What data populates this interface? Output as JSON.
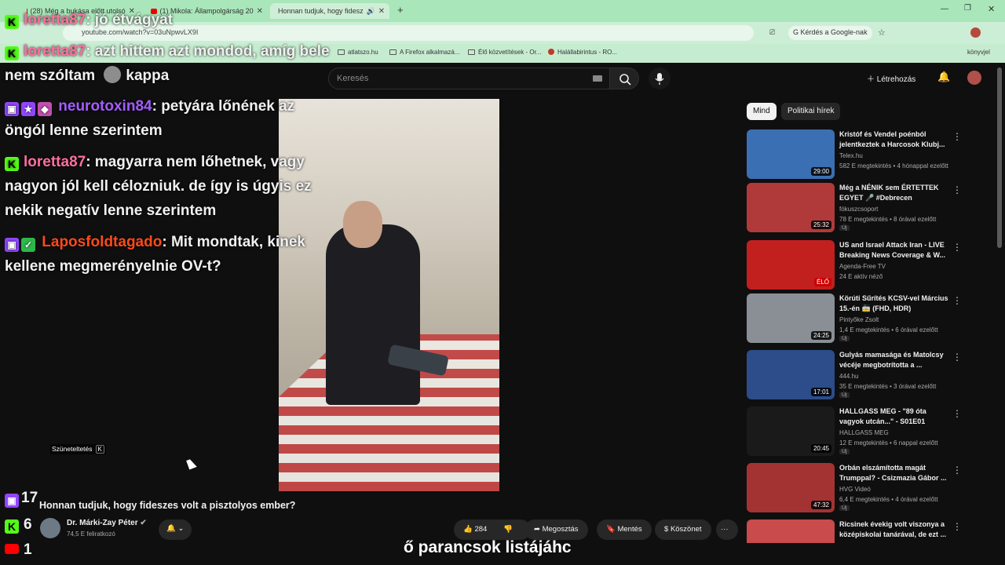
{
  "browser": {
    "tabs": [
      {
        "label": "(28) Még a bukása előtt utolsó",
        "active": false
      },
      {
        "label": "(1) Mikola: Állampolgárság 20",
        "active": false
      },
      {
        "label": "Honnan tudjuk, hogy fidesz",
        "active": true
      }
    ],
    "new_tab_symbol": "+",
    "url": "youtube.com/watch?v=03uNpwvLX9I",
    "google_question": "Kérdés a Google-nak",
    "bookmarks": [
      {
        "label": "atlatszo.hu"
      },
      {
        "label": "A Firefox alkalmazá..."
      },
      {
        "label": "Élő közvetítések - Or..."
      },
      {
        "label": "Halállabirintus - RO..."
      }
    ],
    "bookmarks_right": "könyvjel"
  },
  "youtube": {
    "search_placeholder": "Keresés",
    "create_label": "Létrehozás",
    "chips": [
      "Mind",
      "Politikai hírek"
    ],
    "video_title": "Honnan tudjuk, hogy fideszes volt a pisztolyos ember?",
    "channel_name": "Dr. Márki-Zay Péter",
    "subscribers": "74,5 E feliratkozó",
    "likes": "284",
    "share_label": "Megosztás",
    "save_label": "Mentés",
    "thanks_label": "Köszönet",
    "more_label": "···",
    "pause_hint": "Szüneteltetés",
    "pause_key": "K",
    "recommendations": [
      {
        "title": "Kristóf és Vendel poénból jelentkeztek a Harcosok Klubj...",
        "channel": "Telex.hu",
        "meta": "582 E megtekintés • 4 hónappal ezelőtt",
        "duration": "29:00",
        "new": "",
        "thumb_color": "#3b6fb3"
      },
      {
        "title": "Még a NÉNIK sem ÉRTETTEK EGYET 🎤 #Debrecen",
        "channel": "fókuszcsoport",
        "meta": "78 E megtekintés • 8 órával ezelőtt",
        "duration": "25:32",
        "new": "Új",
        "thumb_color": "#b03a3a"
      },
      {
        "title": "US and Israel Attack Iran - LIVE Breaking News Coverage & W...",
        "channel": "Agenda-Free TV",
        "meta": "24 E aktív néző",
        "duration": "ÉLŐ",
        "new": "",
        "thumb_color": "#c21f1f"
      },
      {
        "title": "Körúti Sűrítés KCSV-vel Március 15.-én 🚋 (FHD, HDR)",
        "channel": "Pintyőke Zsolt",
        "meta": "1,4 E megtekintés • 6 órával ezelőtt",
        "duration": "24:25",
        "new": "Új",
        "thumb_color": "#8a8f96"
      },
      {
        "title": "Gulyás mamasága és Matolcsy vécéje megbotrította a ...",
        "channel": "444.hu",
        "meta": "35 E megtekintés • 3 órával ezelőtt",
        "duration": "17:01",
        "new": "Új",
        "thumb_color": "#2c4d8a"
      },
      {
        "title": "HALLGASS MEG - \"89 óta vagyok utcán...\" - S01E01",
        "channel": "HALLGASS MEG",
        "meta": "12 E megtekintés • 6 nappal ezelőtt",
        "duration": "20:45",
        "new": "Új",
        "thumb_color": "#1a1a1a"
      },
      {
        "title": "Orbán elszámította magát Trumppal? - Csizmazia Gábor ...",
        "channel": "HVG Videó",
        "meta": "6,4 E megtekintés • 4 órával ezelőtt",
        "duration": "47:32",
        "new": "Új",
        "thumb_color": "#a33333"
      },
      {
        "title": "Ricsinek évekig volt viszonya a középiskolai tanárával, de ezt ...",
        "channel": "",
        "meta": "",
        "duration": "",
        "new": "",
        "thumb_color": "#c94b4b"
      }
    ]
  },
  "chat": [
    {
      "platform": "kick",
      "user": "loretta87",
      "user_color": "#ff6fa0",
      "text": ": jó étvágyat"
    },
    {
      "platform": "kick",
      "user": "loretta87",
      "user_color": "#ff6fa0",
      "text": ": azt hittem azt mondod, amíg bele nem szóltam",
      "emote": "kappa"
    },
    {
      "platform": "twitch",
      "user": "neurotoxin84",
      "user_color": "#a45cff",
      "text": ": petyára lőnének az öngól lenne szerintem"
    },
    {
      "platform": "kick",
      "user": "loretta87",
      "user_color": "#ff6fa0",
      "text": ": magyarra nem lőhetnek, vagy nagyon jól kell célozniuk. de így is úgyis ez nekik negatív lenne szerintem"
    },
    {
      "platform": "twitch",
      "user": "Laposfoldtagado",
      "user_color": "#ff4a1a",
      "text": ": Mit mondtak, kinek kellene megmerényelnie OV-t?"
    }
  ],
  "viewer_counts": {
    "twitch": "17",
    "kick": "6",
    "youtube": "1"
  },
  "caption": "ő parancsok listájáhc",
  "colors": {
    "kick": "#53fc18",
    "twitch": "#9146ff",
    "youtube": "#ff0000",
    "bg": "#0f0f0f"
  }
}
